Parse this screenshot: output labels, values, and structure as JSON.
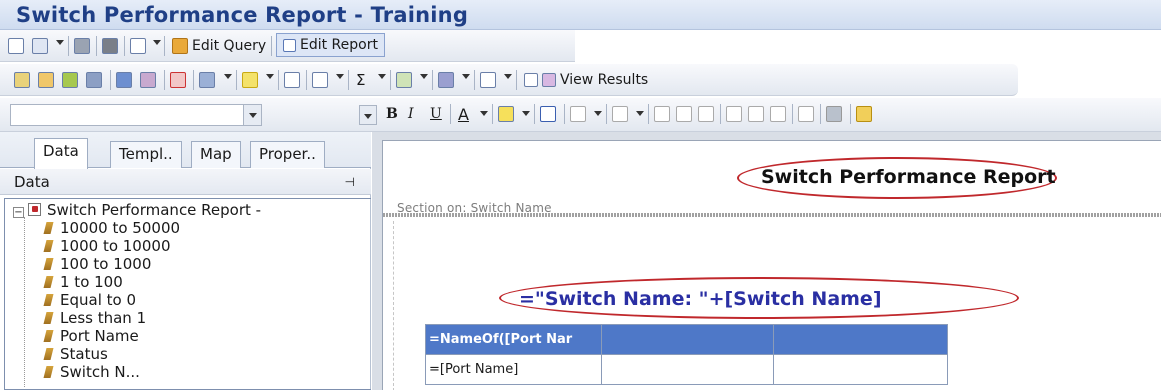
{
  "window": {
    "title": "Switch Performance Report - Training"
  },
  "toolbar1": {
    "edit_query_label": "Edit Query",
    "edit_report_label": "Edit Report"
  },
  "toolbar2": {
    "view_results_label": "View Results"
  },
  "toolbar3": {
    "bold": "B",
    "italic": "I",
    "underline": "U",
    "font_color": "A"
  },
  "left_panel": {
    "tabs": [
      "Data",
      "Templ..",
      "Map",
      "Proper.."
    ],
    "header": "Data",
    "pin_glyph": "⊣",
    "tree": {
      "root": "Switch Performance Report -",
      "items": [
        "10000 to 50000",
        "1000 to 10000",
        "100 to 1000",
        "1 to 100",
        "Equal to 0",
        "Less than 1",
        "Port Name",
        "Status",
        "Switch N..."
      ]
    }
  },
  "report": {
    "title": "Switch Performance Report",
    "section_label": "Section on: Switch Name",
    "formula": "=\"Switch Name: \"+[Switch Name]",
    "table": {
      "header": [
        "=NameOf([Port Nar",
        "",
        ""
      ],
      "row": [
        "=[Port Name]",
        "",
        ""
      ]
    }
  },
  "colors": {
    "title_blue": "#1f3f86",
    "annotation_red": "#c0282c",
    "table_header": "#4e78c8",
    "formula_blue": "#2a2fa3"
  }
}
